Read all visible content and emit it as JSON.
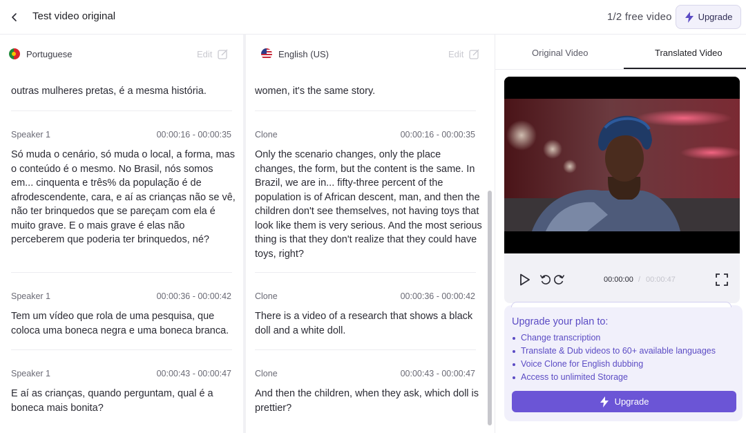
{
  "header": {
    "title": "Test video original",
    "free_counter": "1/2 free video",
    "upgrade_label": "Upgrade"
  },
  "source": {
    "language": "Portuguese",
    "edit_label": "Edit",
    "partial_top": "outras mulheres pretas, é a mesma história.",
    "segments": [
      {
        "speaker": "Speaker 1",
        "time": "00:00:16 - 00:00:35",
        "text": "Só muda o cenário, só muda o local, a forma, mas o conteúdo é o mesmo. No Brasil, nós somos em... cinquenta e três% da população é de afrodescendente, cara, e aí as crianças não se vê, não ter brinquedos que se pareçam com ela é muito grave. E o mais grave é elas não perceberem que poderia ter brinquedos, né?"
      },
      {
        "speaker": "Speaker 1",
        "time": "00:00:36 - 00:00:42",
        "text": "Tem um vídeo que rola de uma pesquisa, que coloca uma boneca negra e uma boneca branca."
      },
      {
        "speaker": "Speaker 1",
        "time": "00:00:43 - 00:00:47",
        "text": "E aí as crianças, quando perguntam, qual é a boneca mais bonita?"
      }
    ]
  },
  "translation": {
    "language": "English (US)",
    "edit_label": "Edit",
    "partial_top": "women, it's the same story.",
    "segments": [
      {
        "speaker": "Clone",
        "time": "00:00:16 - 00:00:35",
        "text": "Only the scenario changes, only the place changes, the form, but the content is the same. In Brazil, we are in... fifty-three percent of the population is of African descent, man, and then the children don't see themselves, not having toys that look like them is very serious. And the most serious thing is that they don't realize that they could have toys, right?"
      },
      {
        "speaker": "Clone",
        "time": "00:00:36 - 00:00:42",
        "text": "There is a video of a research that shows a black doll and a white doll."
      },
      {
        "speaker": "Clone",
        "time": "00:00:43 - 00:00:47",
        "text": "And then the children, when they ask, which doll is prettier?"
      }
    ]
  },
  "tabs": {
    "original": "Original Video",
    "translated": "Translated Video"
  },
  "player": {
    "current_time": "00:00:00",
    "separator": "/",
    "duration": "00:00:47"
  },
  "upgrade_card": {
    "title": "Upgrade your plan to:",
    "items": [
      "Change transcription",
      "Translate & Dub videos to 60+ available languages",
      "Voice Clone for English dubbing",
      "Access to unlimited Storage"
    ],
    "button_label": "Upgrade"
  },
  "colors": {
    "accent": "#6b55d6",
    "accent_text": "#5b4bc4"
  }
}
